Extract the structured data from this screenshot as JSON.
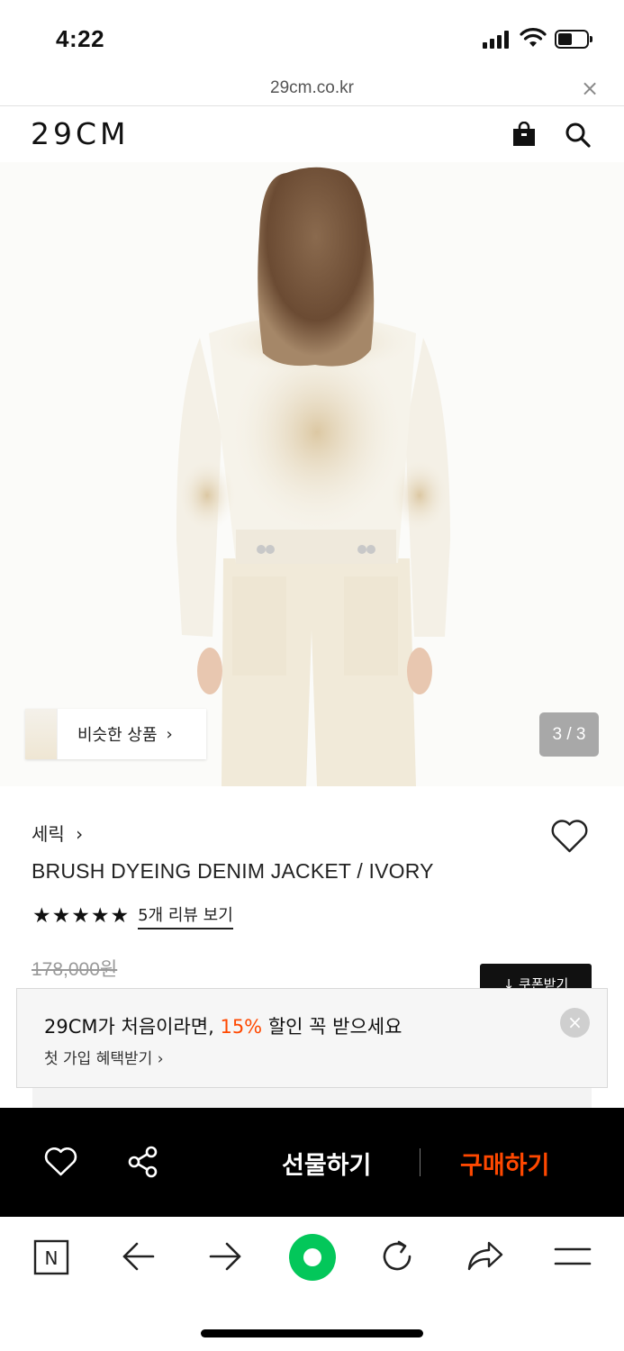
{
  "status_bar": {
    "time": "4:22"
  },
  "url_bar": {
    "url": "29cm.co.kr",
    "close_glyph": "×"
  },
  "site_header": {
    "logo": "29CM",
    "icons": [
      "shopping-bag-icon",
      "search-icon"
    ]
  },
  "product_image": {
    "similar_label": "비슷한 상품",
    "similar_chevron": "›",
    "counter": "3 / 3"
  },
  "product": {
    "brand": "세릭",
    "brand_chevron": "›",
    "name": "BRUSH DYEING DENIM JACKET / IVORY",
    "stars": "★★★★★",
    "rating": 5,
    "review_link": "5개 리뷰 보기",
    "original_price": "178,000원",
    "coupon_label": "↓ 쿠폰받기"
  },
  "signup_banner": {
    "title_prefix": "29CM가 처음이라면, ",
    "title_highlight": "15%",
    "title_suffix": " 할인 꼭 받으세요",
    "subtitle": "첫 가입 혜택받기 ›",
    "close_glyph": "×"
  },
  "purchase_bar": {
    "gift_label": "선물하기",
    "buy_label": "구매하기",
    "icons": [
      "heart-icon",
      "share-icon"
    ]
  },
  "browser_toolbar": {
    "icons": [
      "naver-n-icon",
      "back-arrow-icon",
      "forward-arrow-icon",
      "green-dot-icon",
      "reload-icon",
      "share-arrow-icon",
      "menu-icon"
    ],
    "naver_glyph": "N"
  },
  "colors": {
    "accent": "#ff4800",
    "black": "#000000",
    "green": "#03c75a",
    "counter_bg": "#a8a8a8"
  }
}
